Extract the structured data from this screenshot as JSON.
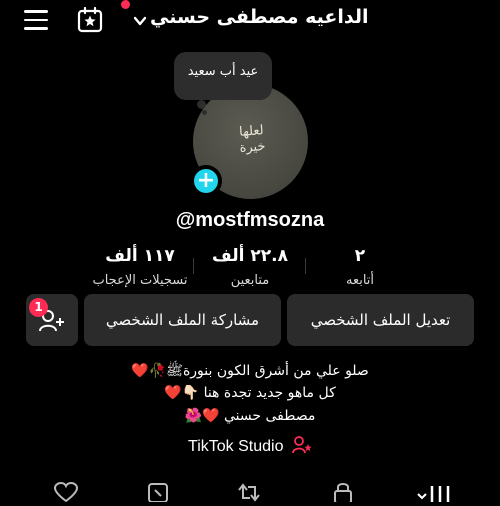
{
  "header": {
    "display_name": "الداعيه مصطفى حسني",
    "menu_icon": "menu-icon",
    "calendar_icon": "calendar-star-icon",
    "chevron_icon": "chevron-down-icon",
    "notification_dot_color": "#fe2c55"
  },
  "profile": {
    "note": "عيد أب سعيد",
    "avatar_text": "لعلها خيرة",
    "handle": "@mostfmsozna",
    "add_icon": "plus-icon"
  },
  "stats": [
    {
      "value": "٢",
      "label": "أتابعه"
    },
    {
      "value": "٢٢.٨ ألف",
      "label": "متابعين"
    },
    {
      "value": "١١٧ ألف",
      "label": "تسجيلات الإعجاب"
    }
  ],
  "actions": {
    "edit_profile": "تعديل الملف الشخصي",
    "share_profile": "مشاركة الملف الشخصي",
    "friend_requests_count": "1",
    "add_friend_icon": "add-user-icon"
  },
  "bio": {
    "line1": "صلو علي من أشرق الكون بنورةﷺ🥀❤️",
    "line2": "كل ماهو جديد تجدة هنا 👇🏻❤️",
    "line3": "مصطفى حسني ❤️🌺"
  },
  "studio": {
    "label": "TikTok Studio",
    "icon": "studio-person-icon",
    "accent_color": "#fe2c55"
  },
  "tabs": [
    "videos-grid-icon",
    "lock-icon",
    "repost-icon",
    "favorites-icon",
    "liked-icon"
  ]
}
